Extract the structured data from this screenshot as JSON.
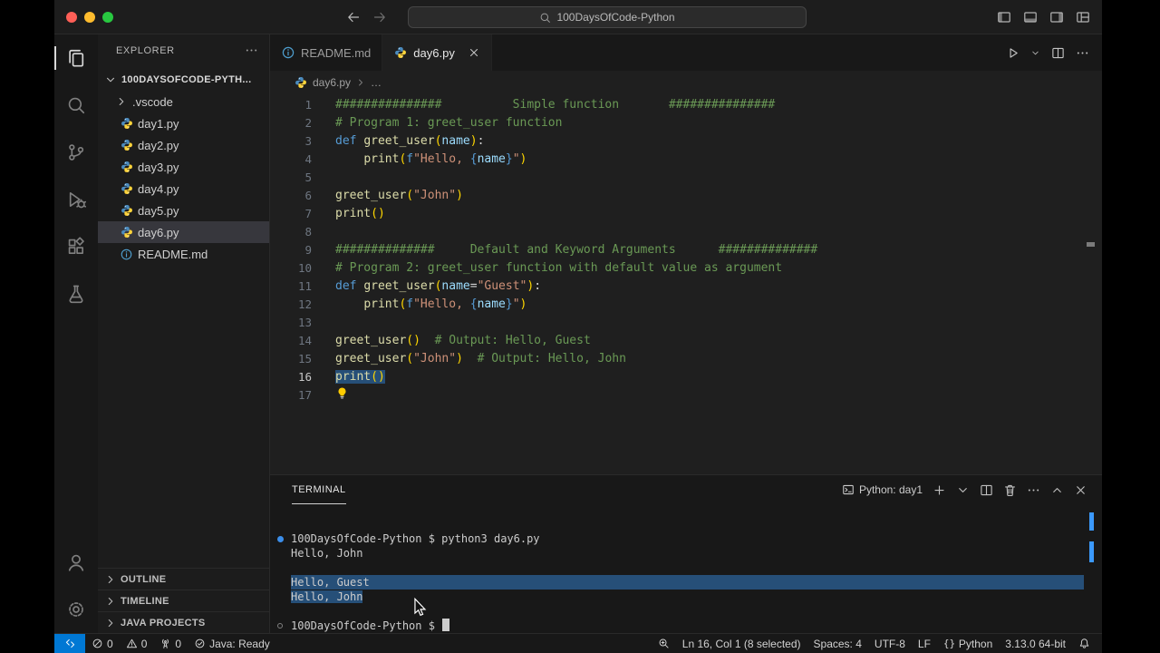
{
  "colors": {
    "accent": "#0078D4",
    "selection": "#264F78",
    "list_active": "#37373D",
    "python_blue": "#4B8BBE",
    "python_yellow": "#FFD43B",
    "traffic_lights": [
      "#FF5F57",
      "#FEBC2E",
      "#28C840"
    ]
  },
  "title_bar": {
    "search_text": "100DaysOfCode-Python",
    "nav": [
      {
        "name": "back-button",
        "icon": "arrow-left",
        "dim": false
      },
      {
        "name": "forward-button",
        "icon": "arrow-right",
        "dim": true
      }
    ],
    "actions": [
      {
        "name": "toggle-primary-sidebar-button",
        "icon": "layout-sidebar-left"
      },
      {
        "name": "toggle-panel-button",
        "icon": "layout-panel"
      },
      {
        "name": "toggle-secondary-sidebar-button",
        "icon": "layout-sidebar-right"
      },
      {
        "name": "customize-layout-button",
        "icon": "customize-layout"
      }
    ]
  },
  "activity_bar": {
    "top": [
      {
        "name": "explorer",
        "icon": "files",
        "active": true
      },
      {
        "name": "search",
        "icon": "search",
        "active": false
      },
      {
        "name": "source-control",
        "icon": "source-control",
        "active": false
      },
      {
        "name": "run-and-debug",
        "icon": "debug",
        "active": false
      },
      {
        "name": "extensions",
        "icon": "extensions",
        "active": false
      },
      {
        "name": "testing",
        "icon": "beaker",
        "active": false
      }
    ],
    "bottom": [
      {
        "name": "accounts",
        "icon": "account",
        "active": false
      },
      {
        "name": "settings",
        "icon": "gear",
        "active": false
      }
    ]
  },
  "sidebar": {
    "header": "EXPLORER",
    "root_label": "100DAYSOFCODE-PYTH...",
    "items": [
      {
        "label": ".vscode",
        "type": "folder"
      },
      {
        "label": "day1.py",
        "icon": "python"
      },
      {
        "label": "day2.py",
        "icon": "python"
      },
      {
        "label": "day3.py",
        "icon": "python"
      },
      {
        "label": "day4.py",
        "icon": "python"
      },
      {
        "label": "day5.py",
        "icon": "python"
      },
      {
        "label": "day6.py",
        "icon": "python",
        "selected": true
      },
      {
        "label": "README.md",
        "icon": "info"
      }
    ],
    "sections": [
      {
        "label": "OUTLINE"
      },
      {
        "label": "TIMELINE"
      },
      {
        "label": "JAVA PROJECTS"
      }
    ]
  },
  "tabs": [
    {
      "label": "README.md",
      "icon": "info",
      "active": false
    },
    {
      "label": "day6.py",
      "icon": "python",
      "active": true
    }
  ],
  "tab_actions": [
    {
      "name": "run-python-file-button",
      "icon": "run"
    },
    {
      "name": "run-dropdown-button",
      "icon": "chevron-down",
      "small": true
    },
    {
      "name": "split-editor-button",
      "icon": "split-editor"
    },
    {
      "name": "editor-more-actions-button",
      "icon": "more"
    }
  ],
  "breadcrumb": {
    "file": "day6.py",
    "more": "…"
  },
  "editor": {
    "colors": {
      "comment": "#6A9955",
      "kw": "#569CD6",
      "fn": "#DCDCAA",
      "var": "#9CDCFE",
      "str": "#CE9178",
      "brk": "#FFD700",
      "op": "#D4D4D4",
      "txt": "#D4D4D4"
    },
    "lines": [
      {
        "n": 1,
        "segs": [
          [
            "###############          Simple function       ###############",
            "comment"
          ]
        ]
      },
      {
        "n": 2,
        "segs": [
          [
            "# Program 1: greet_user function",
            "comment"
          ]
        ]
      },
      {
        "n": 3,
        "segs": [
          [
            "def ",
            "kw"
          ],
          [
            "greet_user",
            "fn"
          ],
          [
            "(",
            "brk"
          ],
          [
            "name",
            "var"
          ],
          [
            ")",
            "brk"
          ],
          [
            ":",
            "txt"
          ]
        ]
      },
      {
        "n": 4,
        "segs": [
          [
            "    ",
            "txt"
          ],
          [
            "print",
            "fn"
          ],
          [
            "(",
            "brk"
          ],
          [
            "f",
            "kw"
          ],
          [
            "\"Hello, ",
            "str"
          ],
          [
            "{",
            "kw"
          ],
          [
            "name",
            "var"
          ],
          [
            "}",
            "kw"
          ],
          [
            "\"",
            "str"
          ],
          [
            ")",
            "brk"
          ]
        ]
      },
      {
        "n": 5,
        "segs": []
      },
      {
        "n": 6,
        "segs": [
          [
            "greet_user",
            "fn"
          ],
          [
            "(",
            "brk"
          ],
          [
            "\"John\"",
            "str"
          ],
          [
            ")",
            "brk"
          ]
        ]
      },
      {
        "n": 7,
        "segs": [
          [
            "print",
            "fn"
          ],
          [
            "()",
            "brk"
          ]
        ]
      },
      {
        "n": 8,
        "segs": []
      },
      {
        "n": 9,
        "segs": [
          [
            "##############     Default and Keyword Arguments      ##############",
            "comment"
          ]
        ]
      },
      {
        "n": 10,
        "segs": [
          [
            "# Program 2: greet_user function with default value as argument",
            "comment"
          ]
        ]
      },
      {
        "n": 11,
        "segs": [
          [
            "def ",
            "kw"
          ],
          [
            "greet_user",
            "fn"
          ],
          [
            "(",
            "brk"
          ],
          [
            "name",
            "var"
          ],
          [
            "=",
            "op"
          ],
          [
            "\"Guest\"",
            "str"
          ],
          [
            ")",
            "brk"
          ],
          [
            ":",
            "txt"
          ]
        ]
      },
      {
        "n": 12,
        "segs": [
          [
            "    ",
            "txt"
          ],
          [
            "print",
            "fn"
          ],
          [
            "(",
            "brk"
          ],
          [
            "f",
            "kw"
          ],
          [
            "\"Hello, ",
            "str"
          ],
          [
            "{",
            "kw"
          ],
          [
            "name",
            "var"
          ],
          [
            "}",
            "kw"
          ],
          [
            "\"",
            "str"
          ],
          [
            ")",
            "brk"
          ]
        ]
      },
      {
        "n": 13,
        "segs": []
      },
      {
        "n": 14,
        "segs": [
          [
            "greet_user",
            "fn"
          ],
          [
            "()",
            "brk"
          ],
          [
            "  ",
            "txt"
          ],
          [
            "# Output: Hello, Guest",
            "comment"
          ]
        ]
      },
      {
        "n": 15,
        "segs": [
          [
            "greet_user",
            "fn"
          ],
          [
            "(",
            "brk"
          ],
          [
            "\"John\"",
            "str"
          ],
          [
            ")",
            "brk"
          ],
          [
            "  ",
            "txt"
          ],
          [
            "# Output: Hello, John",
            "comment"
          ]
        ]
      },
      {
        "n": 16,
        "sel": true,
        "active": true,
        "segs": [
          [
            "print",
            "fn"
          ],
          [
            "()",
            "brk"
          ]
        ]
      },
      {
        "n": 17,
        "lightbulb": true,
        "segs": []
      }
    ]
  },
  "terminal": {
    "title": "TERMINAL",
    "shell_label": "Python: day1",
    "shell_icon": "terminal-shell",
    "actions": [
      {
        "name": "new-terminal-button",
        "icon": "plus"
      },
      {
        "name": "terminal-dropdown-button",
        "icon": "chevron-down",
        "small": true
      },
      {
        "name": "split-terminal-button",
        "icon": "split-editor"
      },
      {
        "name": "kill-terminal-button",
        "icon": "trash"
      },
      {
        "name": "terminal-more-actions-button",
        "icon": "more"
      },
      {
        "name": "maximize-panel-button",
        "icon": "chevron-up"
      },
      {
        "name": "close-panel-button",
        "icon": "close"
      }
    ],
    "lines": [
      {
        "text": "100DaysOfCode-Python $ python3 day6.py",
        "deco": "command"
      },
      {
        "text": "Hello, John"
      },
      {
        "text": ""
      },
      {
        "text": "Hello, Guest",
        "sel": "full"
      },
      {
        "text": "Hello, John",
        "sel": "text"
      },
      {
        "text": ""
      },
      {
        "text": "100DaysOfCode-Python $ ",
        "deco": "prompt",
        "cursor": true
      }
    ]
  },
  "status_bar": {
    "left": [
      {
        "name": "remote",
        "icon": "remote",
        "label": ""
      },
      {
        "name": "errors",
        "icon": "error",
        "label": "0"
      },
      {
        "name": "warnings",
        "icon": "warning",
        "label": "0"
      },
      {
        "name": "ports",
        "icon": "radio-tower",
        "label": "0"
      },
      {
        "name": "java-status",
        "icon": "java-check",
        "label": "Java: Ready"
      }
    ],
    "right": [
      {
        "name": "zoom-indicator",
        "icon": "zoom",
        "label": ""
      },
      {
        "name": "cursor-position",
        "label": "Ln 16, Col 1 (8 selected)"
      },
      {
        "name": "indentation",
        "label": "Spaces: 4"
      },
      {
        "name": "encoding",
        "label": "UTF-8"
      },
      {
        "name": "eol",
        "label": "LF"
      },
      {
        "name": "language-mode",
        "icon": "braces",
        "label": "Python"
      },
      {
        "name": "python-version",
        "label": "3.13.0 64-bit"
      },
      {
        "name": "notifications",
        "icon": "bell",
        "label": ""
      }
    ]
  }
}
